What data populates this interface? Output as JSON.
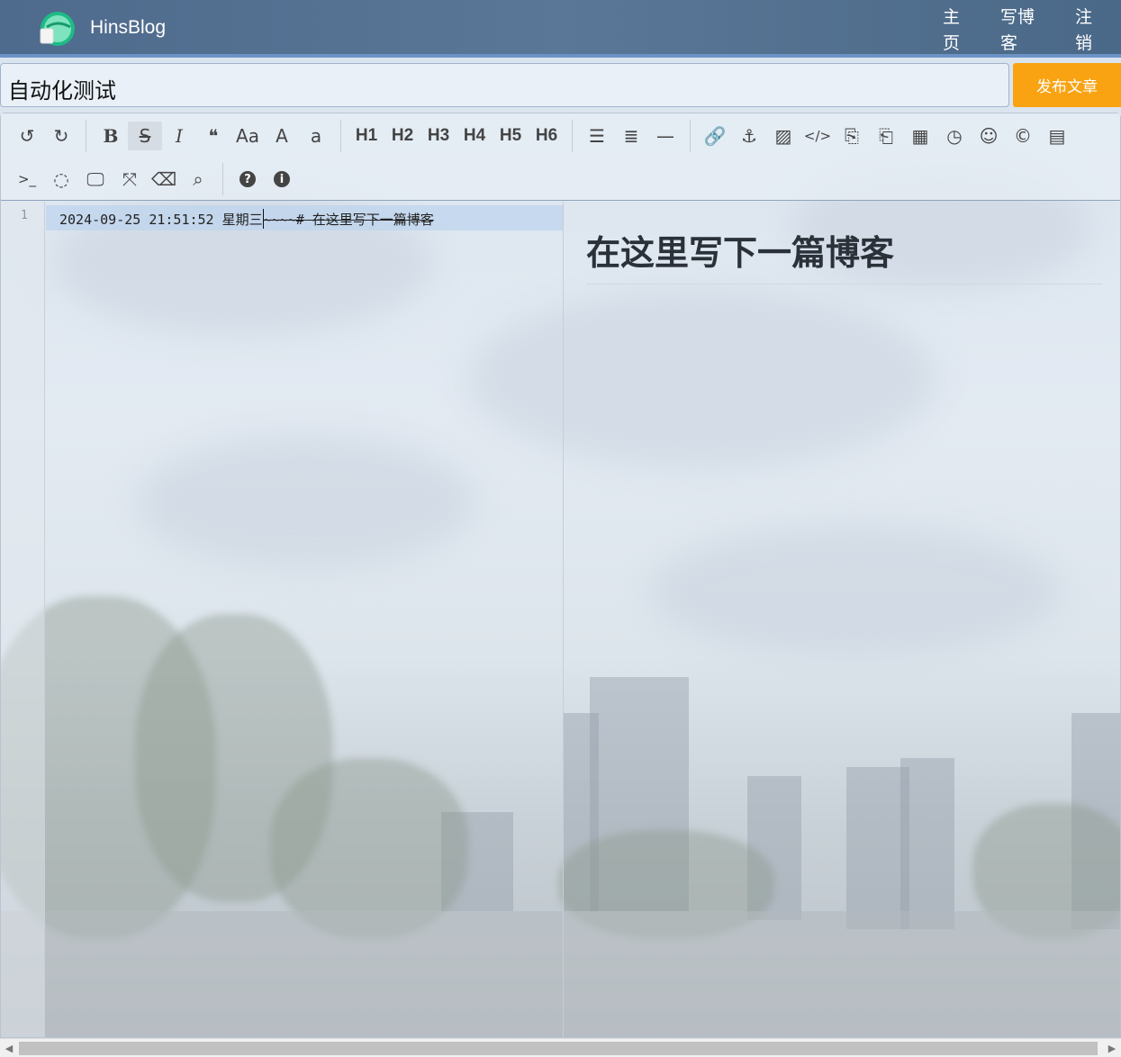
{
  "header": {
    "brand": "HinsBlog",
    "nav": [
      {
        "top": "主",
        "bottom": "页"
      },
      {
        "top": "写博",
        "bottom": "客"
      },
      {
        "top": "注",
        "bottom": "销"
      }
    ]
  },
  "title_row": {
    "title_value": "自动化测试",
    "publish_label": "发布文章"
  },
  "toolbar": {
    "row1": [
      {
        "name": "undo-icon",
        "glyph": "↺"
      },
      {
        "name": "redo-icon",
        "glyph": "↻"
      },
      {
        "sep": true
      },
      {
        "name": "bold-icon",
        "glyph": "B"
      },
      {
        "name": "strikethrough-icon",
        "glyph": "S"
      },
      {
        "name": "italic-icon",
        "glyph": "I"
      },
      {
        "name": "quote-icon",
        "glyph": "❝"
      },
      {
        "name": "uppercase-icon",
        "glyph": "Aa"
      },
      {
        "name": "capitalize-icon",
        "glyph": "A"
      },
      {
        "name": "lowercase-icon",
        "glyph": "a"
      },
      {
        "sep": true
      },
      {
        "name": "h1-button",
        "glyph": "H1",
        "h": true
      },
      {
        "name": "h2-button",
        "glyph": "H2",
        "h": true
      },
      {
        "name": "h3-button",
        "glyph": "H3",
        "h": true
      },
      {
        "name": "h4-button",
        "glyph": "H4",
        "h": true
      },
      {
        "name": "h5-button",
        "glyph": "H5",
        "h": true
      },
      {
        "name": "h6-button",
        "glyph": "H6",
        "h": true
      },
      {
        "sep": true
      },
      {
        "name": "unordered-list-icon",
        "glyph": "☰"
      },
      {
        "name": "ordered-list-icon",
        "glyph": "≣"
      },
      {
        "name": "horizontal-rule-icon",
        "glyph": "—"
      },
      {
        "sep": true
      },
      {
        "name": "link-icon",
        "glyph": "🔗"
      },
      {
        "name": "anchor-icon",
        "glyph": "⚓"
      },
      {
        "name": "image-icon",
        "glyph": "▨"
      },
      {
        "name": "code-icon",
        "glyph": "</>"
      },
      {
        "name": "code-block-icon",
        "glyph": "⎘"
      },
      {
        "name": "code-file-icon",
        "glyph": "⎗"
      },
      {
        "name": "table-icon",
        "glyph": "▦"
      },
      {
        "name": "datetime-icon",
        "glyph": "◷"
      },
      {
        "name": "emoji-icon",
        "glyph": "☺"
      },
      {
        "name": "html-entities-icon",
        "glyph": "©"
      },
      {
        "name": "pagebreak-icon",
        "glyph": "▤"
      }
    ],
    "row2": [
      {
        "name": "goto-line-icon",
        "glyph": ">_"
      },
      {
        "name": "unwatch-icon",
        "glyph": "◌"
      },
      {
        "name": "preview-icon",
        "glyph": "🖵"
      },
      {
        "name": "fullscreen-icon",
        "glyph": "⤧"
      },
      {
        "name": "clear-icon",
        "glyph": "⌫"
      },
      {
        "name": "search-icon",
        "glyph": "⌕"
      },
      {
        "sep": true
      },
      {
        "name": "help-icon",
        "glyph": "?"
      },
      {
        "name": "info-icon",
        "glyph": "i"
      }
    ]
  },
  "editor": {
    "line_number": "1",
    "line_prefix": "2024-09-25 21:51:52 星期三",
    "line_struck": "~~~~# 在这里写下一篇博客"
  },
  "preview": {
    "heading": "在这里写下一篇博客"
  },
  "colors": {
    "header_bg": "#4e6a8c",
    "publish_bg": "#f9a313",
    "active_line": "#bed4ee"
  }
}
